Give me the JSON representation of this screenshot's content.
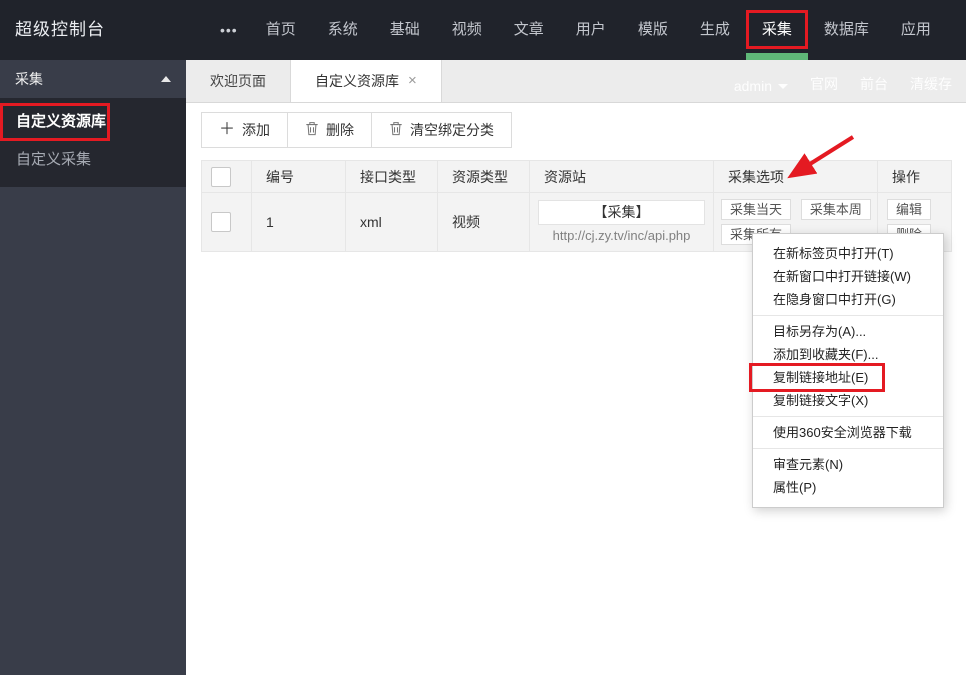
{
  "app": {
    "title": "超级控制台"
  },
  "header": {
    "menu_dots": "•••",
    "nav_items": [
      "首页",
      "系统",
      "基础",
      "视频",
      "文章",
      "用户",
      "模版",
      "生成",
      "采集",
      "数据库",
      "应用"
    ],
    "active_item": "采集"
  },
  "sidebar": {
    "group_label": "采集",
    "items": [
      {
        "label": "自定义资源库",
        "active": true
      },
      {
        "label": "自定义采集",
        "active": false
      }
    ]
  },
  "tabs": {
    "tab1": "欢迎页面",
    "tab2": "自定义资源库",
    "close_icon": "×",
    "active": "自定义资源库"
  },
  "userbar": {
    "username": "admin",
    "links": [
      "官网",
      "前台",
      "清缓存"
    ]
  },
  "toolbar": {
    "add_icon": "＋",
    "add_label": "添加",
    "delete_label": "删除",
    "clear_label": "清空绑定分类"
  },
  "table": {
    "headers": [
      "编号",
      "接口类型",
      "资源类型",
      "资源站",
      "采集选项",
      "操作"
    ],
    "row": {
      "id": "1",
      "api_type": "xml",
      "resource_type": "视频",
      "site_name": "【采集】",
      "site_url": "http://cj.zy.tv/inc/api.php",
      "options": [
        "采集当天",
        "采集本周",
        "采集所有"
      ],
      "actions": [
        "编辑",
        "删除"
      ]
    }
  },
  "context_menu": {
    "items": [
      "在新标签页中打开(T)",
      "在新窗口中打开链接(W)",
      "在隐身窗口中打开(G)",
      "目标另存为(A)...",
      "添加到收藏夹(F)...",
      "复制链接地址(E)",
      "复制链接文字(X)",
      "使用360安全浏览器下载",
      "审查元素(N)",
      "属性(P)"
    ],
    "highlighted_item": "复制链接地址(E)"
  },
  "colors": {
    "header_bg": "#20232b",
    "sidebar_bg": "#393D49",
    "accent_green": "#5FB878",
    "annotation_red": "#e41a22"
  }
}
